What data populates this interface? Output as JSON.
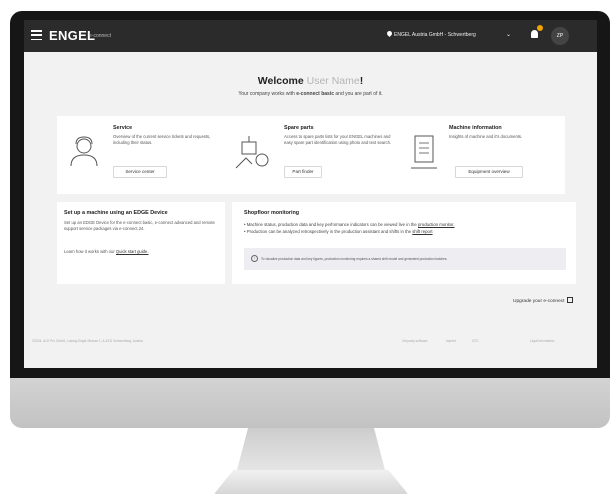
{
  "header": {
    "logo": "ENGEL",
    "subtitle": "e-connect",
    "location": "ENGEL Austria GmbH - Schwertberg",
    "avatar_initials": "ZP",
    "notification_color": "#f0a500"
  },
  "welcome": {
    "greeting": "Welcome",
    "user_name": "User Name",
    "exclamation": "!",
    "subtitle_pre": "Your company works with",
    "subtitle_bold": "e-connect basic",
    "subtitle_post": "and you are part of it."
  },
  "cards": {
    "service": {
      "title": "Service",
      "description": "Overview of the current service tickets and requests, including their status.",
      "button": "Service center"
    },
    "spare_parts": {
      "title": "Spare parts",
      "description": "Access to spare parts lists for your ENGEL machines and easy spare part identification using photo and text search.",
      "button": "Part finder"
    },
    "machine_info": {
      "title": "Machine information",
      "description": "Insights of machine and it's documents.",
      "button": "Equipment overview"
    }
  },
  "setup": {
    "title": "Set up a machine using an EDGE Device",
    "description": "Set up an EDGE Device for the e-connect basic, e-connect advanced and remote support service packages via e-connect.24.",
    "learn_pre": "Learn how it works with our",
    "learn_link": "Quick start guide."
  },
  "shopfloor": {
    "title": "Shopfloor monitoring",
    "bullet1_pre": "Machine status, production data and key performance indicators can be viewed live in the",
    "bullet1_link": "production monitor.",
    "bullet2_pre": "Production can be analyzed retrospectively in the production assistant and shifts in the",
    "bullet2_link": "shift report",
    "info": "To visualize production data and key figures, production monitoring requires a shared shift model and generated production batches."
  },
  "upgrade_label": "Upgrade your e-connect",
  "footer": {
    "left": "©2024, ALD Pro GmbH, Ludwig-Engel-Strasse 1, A-4311 Schwertberg, Austria",
    "links": [
      "3rd party software",
      "Imprint",
      "GTC",
      "Legal information"
    ]
  }
}
